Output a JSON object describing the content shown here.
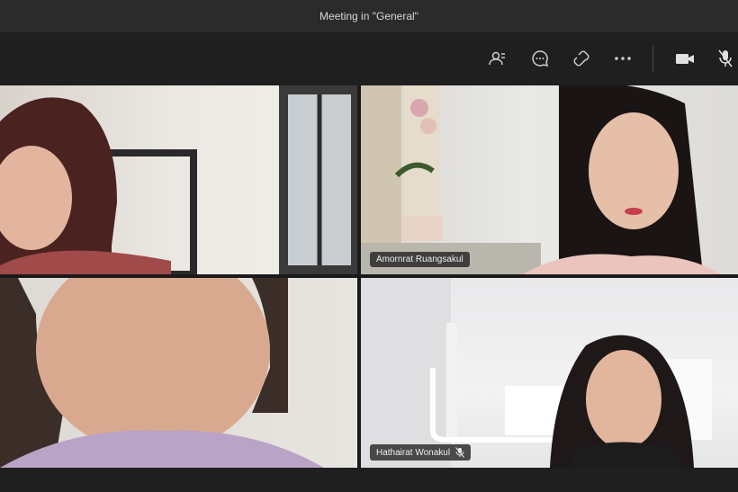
{
  "window": {
    "title": "Meeting in \"General\""
  },
  "toolbar": {
    "buttons": [
      {
        "icon": "people-icon"
      },
      {
        "icon": "chat-icon"
      },
      {
        "icon": "reactions-icon"
      },
      {
        "icon": "more-icon"
      },
      {
        "icon": "camera-icon"
      },
      {
        "icon": "microphone-icon"
      }
    ]
  },
  "participants": [
    {
      "name": "",
      "tile": "top-left"
    },
    {
      "name": "Amornrat Ruangsakul",
      "tile": "top-right"
    },
    {
      "name": "",
      "tile": "bottom-left"
    },
    {
      "name": "Hathairat Wonakul",
      "tile": "bottom-right",
      "muted": true
    }
  ]
}
